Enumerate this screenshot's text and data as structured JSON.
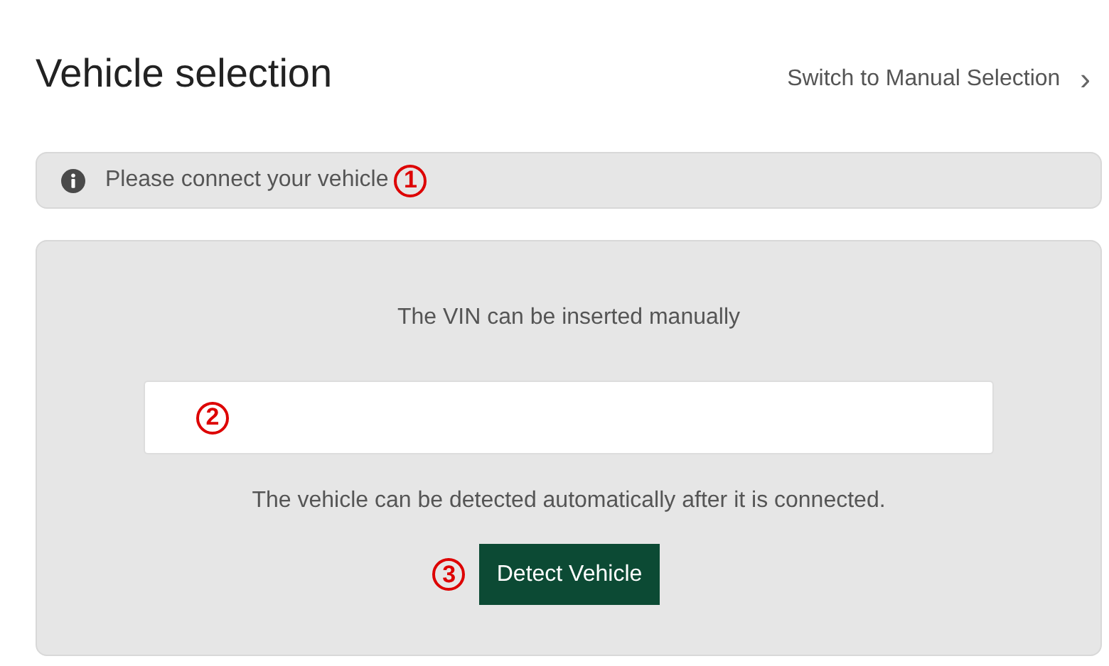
{
  "header": {
    "title": "Vehicle selection",
    "link": "Switch to Manual Selection",
    "link_chevron": "›"
  },
  "notice": {
    "text": "Please connect your vehicle",
    "callout": "1"
  },
  "panel": {
    "vin_label": "The VIN can be inserted manually",
    "vin_field": {
      "callout": "2"
    },
    "detect_text": "The vehicle can be detected automatically after it is connected.",
    "detect_button": {
      "label": "Detect Vehicle",
      "callout": "3"
    }
  }
}
